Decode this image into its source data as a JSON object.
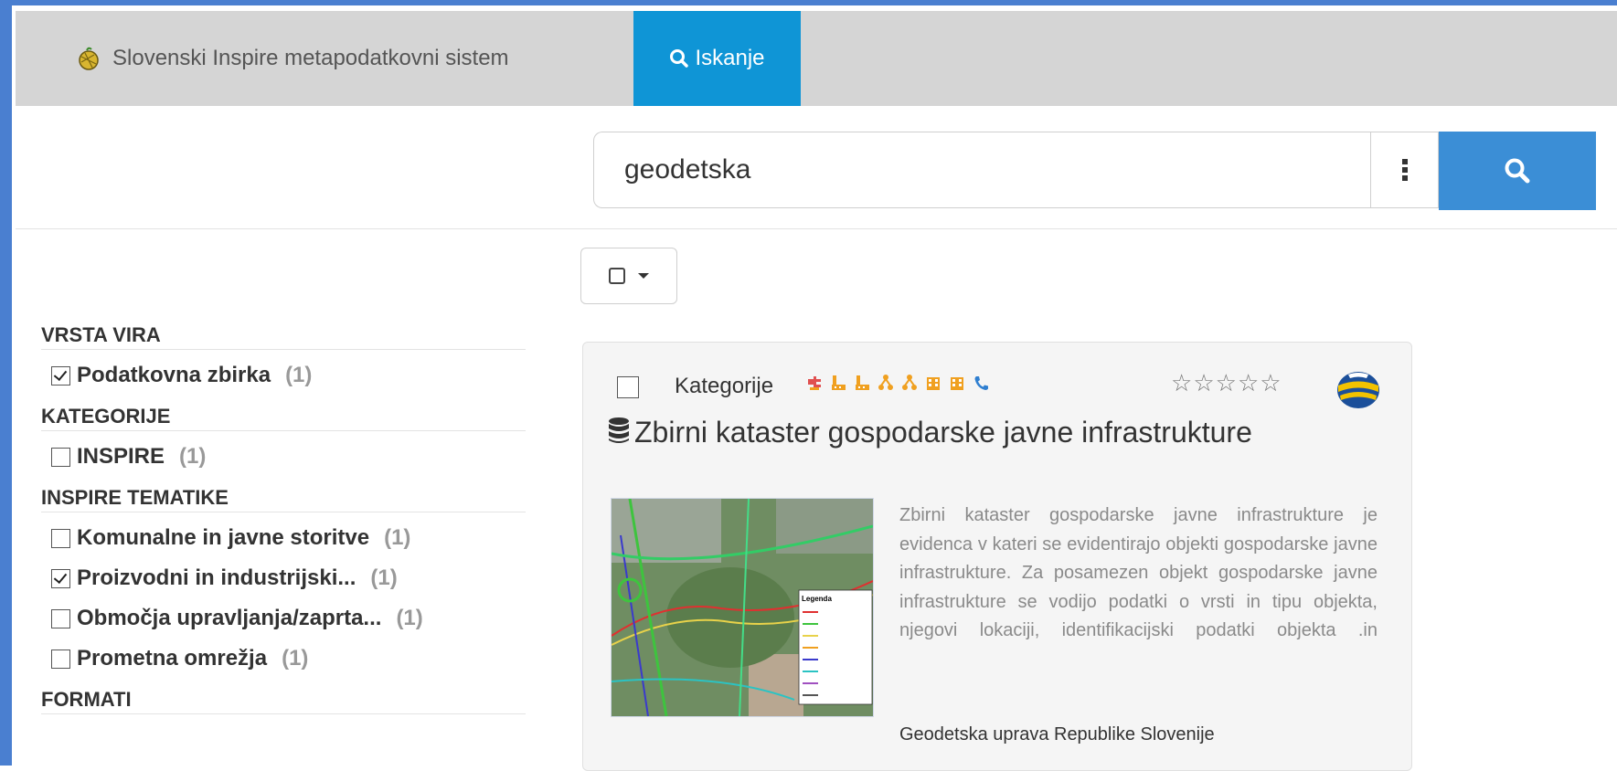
{
  "navbar": {
    "brand_text": "Slovenski Inspire metapodatkovni sistem",
    "search_tab_label": "Iskanje"
  },
  "search": {
    "value": "geodetska"
  },
  "facets": {
    "vrsta_vira": {
      "title": "VRSTA VIRA",
      "items": [
        {
          "label": "Podatkovna zbirka",
          "count": "(1)",
          "checked": true
        }
      ]
    },
    "kategorije": {
      "title": "KATEGORIJE",
      "items": [
        {
          "label": "INSPIRE",
          "count": "(1)",
          "checked": false
        }
      ]
    },
    "inspire_tematike": {
      "title": "INSPIRE TEMATIKE",
      "items": [
        {
          "label": "Komunalne in javne storitve",
          "count": "(1)",
          "checked": false
        },
        {
          "label": "Proizvodni in industrijski...",
          "count": "(1)",
          "checked": true
        },
        {
          "label": "Območja upravljanja/zaprta...",
          "count": "(1)",
          "checked": false
        },
        {
          "label": "Prometna omrežja",
          "count": "(1)",
          "checked": false
        }
      ]
    },
    "formati": {
      "title": "FORMATI"
    }
  },
  "result": {
    "categories_label": "Kategorije",
    "category_icons": [
      "utility-icon",
      "industry-icon",
      "industry-icon",
      "network-icon",
      "network-icon",
      "building-icon",
      "building-icon",
      "phone-icon"
    ],
    "category_icon_colors": {
      "primary": "#f0a020",
      "secondary": "#e05050",
      "phone": "#2f7fd0"
    },
    "rating_stars": 5,
    "title": "Zbirni kataster gospodarske javne infrastrukture",
    "abstract": "Zbirni kataster gospodarske javne infrastrukture je evidenca v kateri se evidentirajo objekti gospodarske javne infrastrukture. Za posamezen objekt gospodarske javne infrastrukture se vodijo podatki o vrsti in tipu objekta, njegovi lokaciji, identifikacijski podatki objekta .in",
    "organisation": "Geodetska uprava Republike Slovenije",
    "thumbnail_legend_title": "Legenda"
  },
  "colors": {
    "navbar_bg": "#d5d5d5",
    "tab_active_bg": "#0f95d6",
    "search_button_bg": "#3b8ed6",
    "frame": "#4a7fd0"
  }
}
